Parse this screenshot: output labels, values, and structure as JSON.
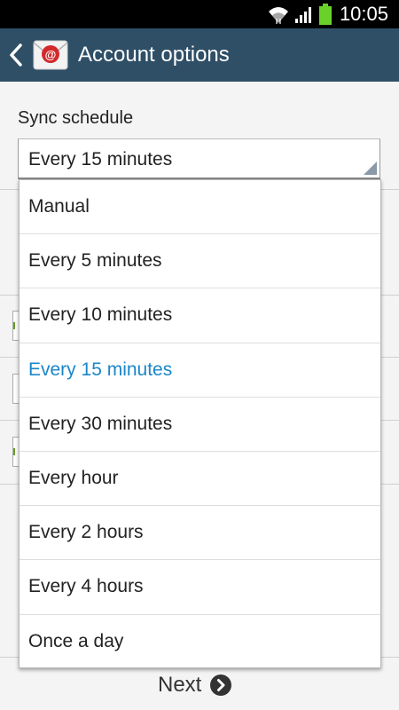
{
  "status_bar": {
    "time": "10:05"
  },
  "action_bar": {
    "title": "Account options"
  },
  "form": {
    "sync_label": "Sync schedule",
    "sync_value": "Every 15 minutes"
  },
  "dropdown": {
    "options": [
      {
        "label": "Manual"
      },
      {
        "label": "Every 5 minutes"
      },
      {
        "label": "Every 10 minutes"
      },
      {
        "label": "Every 15 minutes"
      },
      {
        "label": "Every 30 minutes"
      },
      {
        "label": "Every hour"
      },
      {
        "label": "Every 2 hours"
      },
      {
        "label": "Every 4 hours"
      },
      {
        "label": "Once a day"
      }
    ],
    "selected_index": 3,
    "selected_color": "#1a86c8"
  },
  "footer": {
    "next_label": "Next"
  },
  "colors": {
    "action_bar": "#2f4f67",
    "battery": "#6ad12b"
  }
}
